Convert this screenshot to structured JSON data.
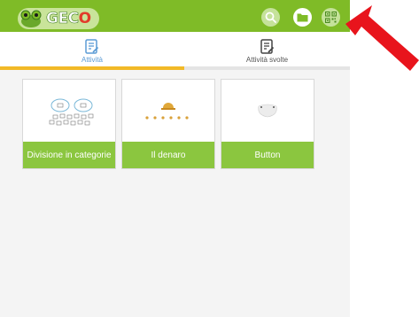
{
  "header": {
    "logo_text": "GECO",
    "icons": [
      "frog-logo-icon",
      "search-icon",
      "folder-icon",
      "qr-code-icon"
    ]
  },
  "tabs": [
    {
      "label": "Attività",
      "icon": "edit-document-icon",
      "active": true
    },
    {
      "label": "Attività svolte",
      "icon": "edit-document-icon",
      "active": false
    }
  ],
  "activities": [
    {
      "label": "Divisione in categorie",
      "thumbnail": "categories-diagram-icon"
    },
    {
      "label": "Il denaro",
      "thumbnail": "bell-and-coins-icon"
    },
    {
      "label": "Button",
      "thumbnail": "white-button-icon"
    }
  ],
  "colors": {
    "header": "#7fbb27",
    "card_label": "#8bc63f",
    "active_tab_indicator": "#f2b927",
    "active_tab_text": "#5b9bd5",
    "annotation_arrow": "#e8141c"
  }
}
